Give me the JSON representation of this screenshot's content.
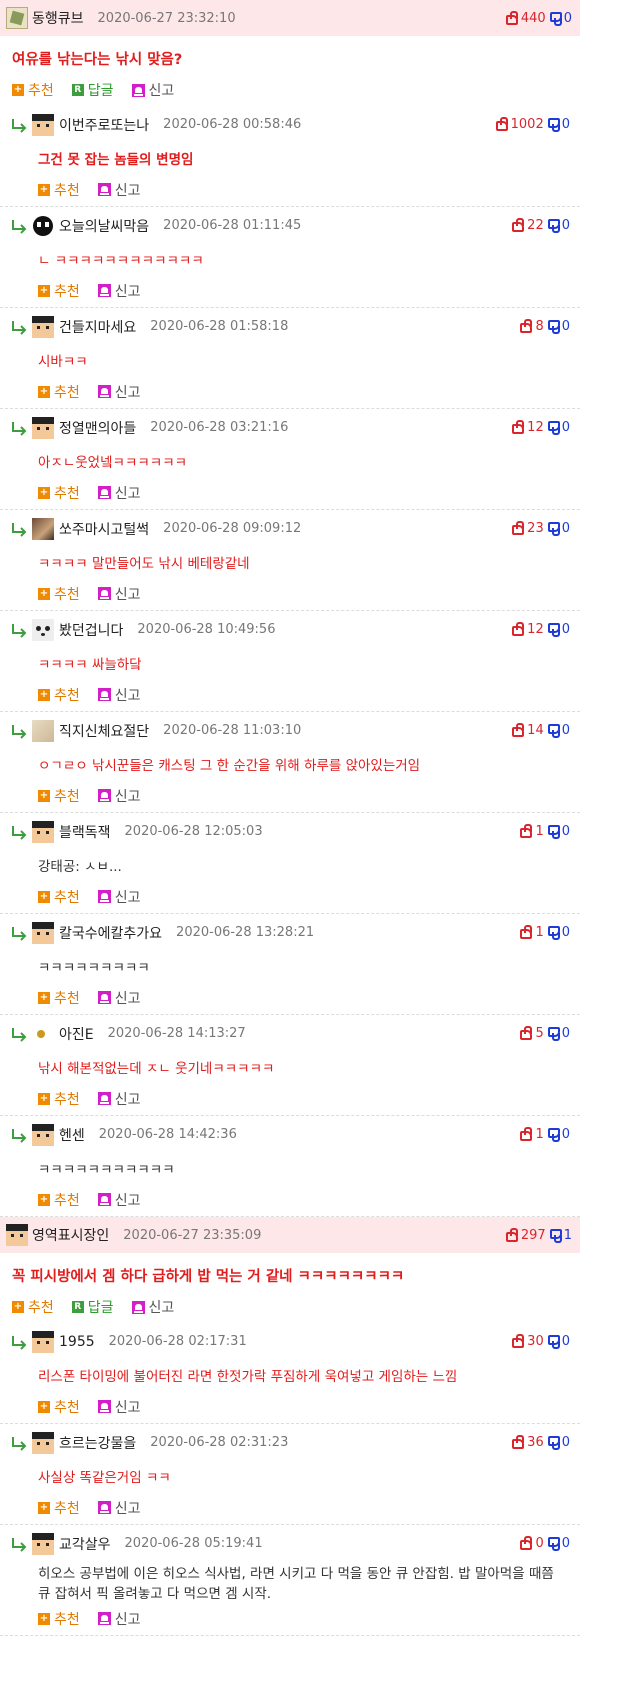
{
  "actions": {
    "recommend": "추천",
    "reply": "답글",
    "report": "신고"
  },
  "colors": {
    "post_bg": "#fde7e8",
    "red_text": "#e21b1b",
    "up": "#d9262c",
    "down": "#1d3bd6"
  },
  "threads": [
    {
      "author": "동행큐브",
      "avatar": "cube-icon",
      "date": "2020-06-27 23:32:10",
      "up": "440",
      "down": "0",
      "text": "여유를 낚는다는 낚시 맞음?",
      "replies": [
        {
          "author": "이번주로또는나",
          "avatar": "face",
          "date": "2020-06-28 00:58:46",
          "up": "1002",
          "down": "0",
          "text": "그건 못 잡는 놈들의 변명임",
          "style": "bold"
        },
        {
          "author": "오늘의날씨막음",
          "avatar": "alien",
          "date": "2020-06-28 01:11:45",
          "up": "22",
          "down": "0",
          "text": "ㄴ ㅋㅋㅋㅋㅋㅋㅋㅋㅋㅋㅋㅋ",
          "style": "red"
        },
        {
          "author": "건들지마세요",
          "avatar": "face",
          "date": "2020-06-28 01:58:18",
          "up": "8",
          "down": "0",
          "text": "시바ㅋㅋ",
          "style": "red"
        },
        {
          "author": "정열맨의아들",
          "avatar": "face",
          "date": "2020-06-28 03:21:16",
          "up": "12",
          "down": "0",
          "text": "아ㅈㄴ웃었넼ㅋㅋㅋㅋㅋㅋ",
          "style": "red"
        },
        {
          "author": "쏘주마시고털썩",
          "avatar": "photo",
          "date": "2020-06-28 09:09:12",
          "up": "23",
          "down": "0",
          "text": "ㅋㅋㅋㅋ 말만들어도 낚시 베테랑같네",
          "style": "red"
        },
        {
          "author": "봤던겁니다",
          "avatar": "panda",
          "date": "2020-06-28 10:49:56",
          "up": "12",
          "down": "0",
          "text": "ㅋㅋㅋㅋ 싸늘하닼",
          "style": "red"
        },
        {
          "author": "직지신체요절단",
          "avatar": "paper",
          "date": "2020-06-28 11:03:10",
          "up": "14",
          "down": "0",
          "text": "ㅇㄱㄹㅇ 낚시꾼들은 캐스팅 그 한 순간을 위해 하루를 앉아있는거임",
          "style": "red"
        },
        {
          "author": "블랙독잭",
          "avatar": "face",
          "date": "2020-06-28 12:05:03",
          "up": "1",
          "down": "0",
          "text": "강태공: ㅅㅂ...",
          "style": "plain"
        },
        {
          "author": "칼국수에칼추가요",
          "avatar": "face",
          "date": "2020-06-28 13:28:21",
          "up": "1",
          "down": "0",
          "text": "ㅋㅋㅋㅋㅋㅋㅋㅋㅋ",
          "style": "plain"
        },
        {
          "author": "아진E",
          "avatar": "dot",
          "date": "2020-06-28 14:13:27",
          "up": "5",
          "down": "0",
          "text": "낚시 해본적없는데 ㅈㄴ 웃기네ㅋㅋㅋㅋㅋ",
          "style": "red"
        },
        {
          "author": "헨센",
          "avatar": "face",
          "date": "2020-06-28 14:42:36",
          "up": "1",
          "down": "0",
          "text": "ㅋㅋㅋㅋㅋㅋㅋㅋㅋㅋㅋ",
          "style": "plain"
        }
      ]
    },
    {
      "author": "영역표시장인",
      "avatar": "face",
      "date": "2020-06-27 23:35:09",
      "up": "297",
      "down": "1",
      "text": "꼭 피시방에서 겜 하다 급하게 밥 먹는 거 같네 ㅋㅋㅋㅋㅋㅋㅋㅋ",
      "replies": [
        {
          "author": "1955",
          "avatar": "face",
          "date": "2020-06-28 02:17:31",
          "up": "30",
          "down": "0",
          "text": "리스폰 타이밍에 불어터진 라면 한젓가락 푸짐하게 욱여넣고 게임하는 느낌",
          "style": "red"
        },
        {
          "author": "흐르는강물을",
          "avatar": "face",
          "date": "2020-06-28 02:31:23",
          "up": "36",
          "down": "0",
          "text": "사실상 똑같은거임 ㅋㅋ",
          "style": "red"
        },
        {
          "author": "교각살우",
          "avatar": "face",
          "date": "2020-06-28 05:19:41",
          "up": "0",
          "down": "0",
          "text": "히오스 공부법에 이은 히오스 식사법, 라면 시키고 다 먹을 동안 큐 안잡힘. 밥 말아먹을 때쯤 큐 잡혀서 픽 올려놓고 다 먹으면 겜 시작.",
          "style": "plain"
        }
      ]
    }
  ]
}
